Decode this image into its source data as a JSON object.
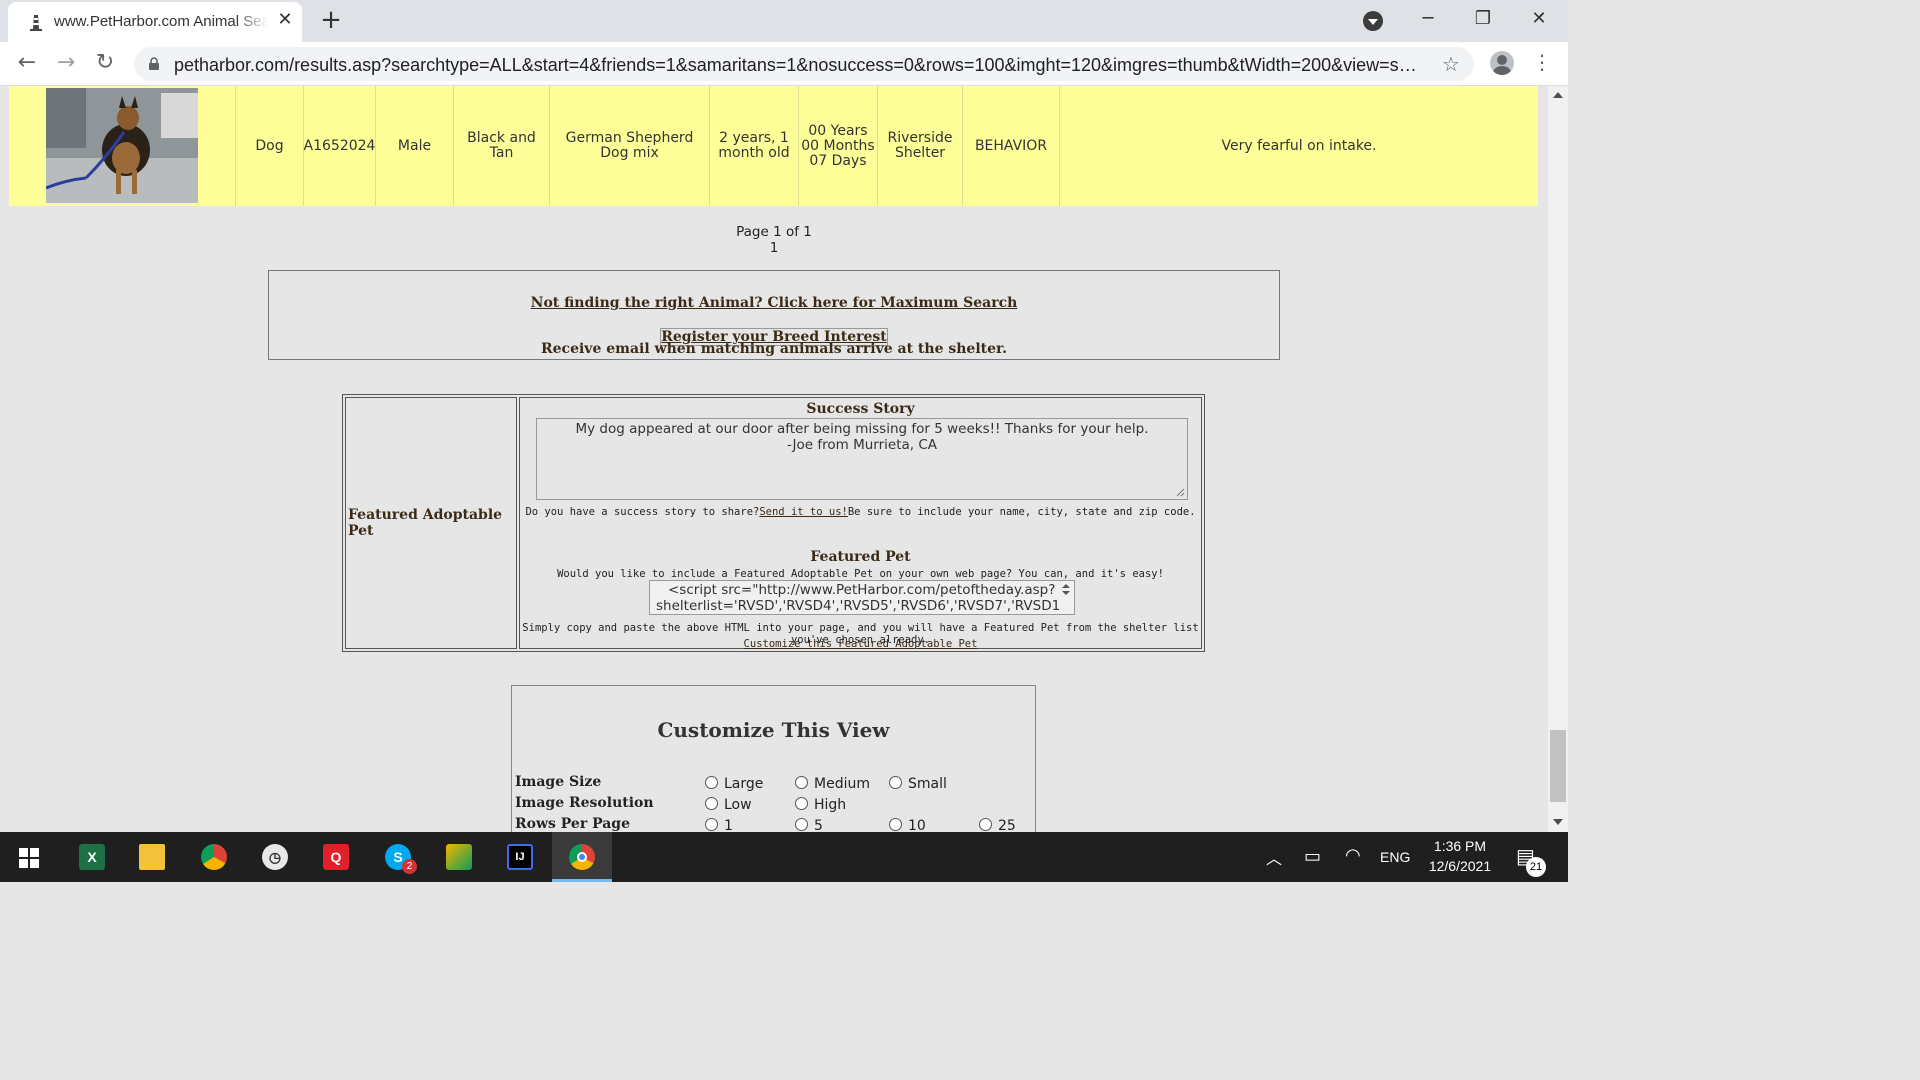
{
  "browser": {
    "tab_title": "www.PetHarbor.com Animal Search",
    "tab_close": "✕",
    "new_tab": "+",
    "url": "petharbor.com/results.asp?searchtype=ALL&start=4&friends=1&samaritans=1&nosuccess=0&rows=100&imght=120&imgres=thumb&tWidth=200&view=sysadm..."
  },
  "result_row": {
    "type": "Dog",
    "id": "A1652024",
    "gender": "Male",
    "color": "Black and Tan",
    "breed": "German Shepherd Dog mix",
    "age": "2 years, 1 month old",
    "time_in_shelter_years": "00 Years",
    "time_in_shelter_months": "00 Months",
    "time_in_shelter_days": "07 Days",
    "shelter": "Riverside Shelter",
    "status": "BEHAVIOR",
    "notes": "Very fearful on intake."
  },
  "pagination": {
    "page_text": "Page 1 of 1",
    "page_link": "1"
  },
  "max_search": {
    "link_text": "Not finding the right Animal? Click here for Maximum Search",
    "register_link": "Register your Breed Interest",
    "register_desc": "Receive email when matching animals arrive at the shelter."
  },
  "featured": {
    "left_label": "Featured Adoptable Pet",
    "success_heading": "Success Story",
    "story_line1": "My dog appeared at our door after being missing for 5 weeks!! Thanks for your help.",
    "story_line2": "-Joe from Murrieta, CA",
    "share_prefix": "Do you have a success story to share?",
    "share_link": "Send it to us!",
    "share_suffix": "Be sure to include your name, city, state and zip code.",
    "pet_heading": "Featured Pet",
    "pet_desc": "Would you like to include a Featured Adoptable Pet on your own web page? You can, and it's easy!",
    "code_line1": "<script src=\"http://www.PetHarbor.com/petoftheday.asp?",
    "code_line2": "shelterlist='RVSD','RVSD4','RVSD5','RVSD6','RVSD7','RVSD1'",
    "copy_instructions": "Simply copy and paste the above HTML into your page, and you will have a Featured Pet from the shelter list you've chosen already.",
    "customize_link": "Customize this Featured Adoptable Pet"
  },
  "customize": {
    "title": "Customize This View",
    "image_size_label": "Image Size",
    "image_size_options": [
      "Large",
      "Medium",
      "Small"
    ],
    "image_resolution_label": "Image Resolution",
    "image_resolution_options": [
      "Low",
      "High"
    ],
    "rows_label": "Rows Per Page",
    "rows_options": [
      "1",
      "5",
      "10",
      "25"
    ]
  },
  "taskbar": {
    "language": "ENG",
    "time": "1:36 PM",
    "date": "12/6/2021",
    "notification_count": "21",
    "skype_badge": "2",
    "apps": [
      "excel-icon",
      "file-explorer-icon",
      "chrome-profile-icon",
      "clock-icon",
      "quip-icon",
      "skype-icon",
      "snip-icon",
      "intellij-icon",
      "chrome-icon"
    ]
  },
  "colors": {
    "result_row_bg": "#ffff99",
    "page_bg": "#e6e6e6",
    "link_brown": "#3b2a16",
    "taskbar_bg": "#1f1f1f"
  }
}
